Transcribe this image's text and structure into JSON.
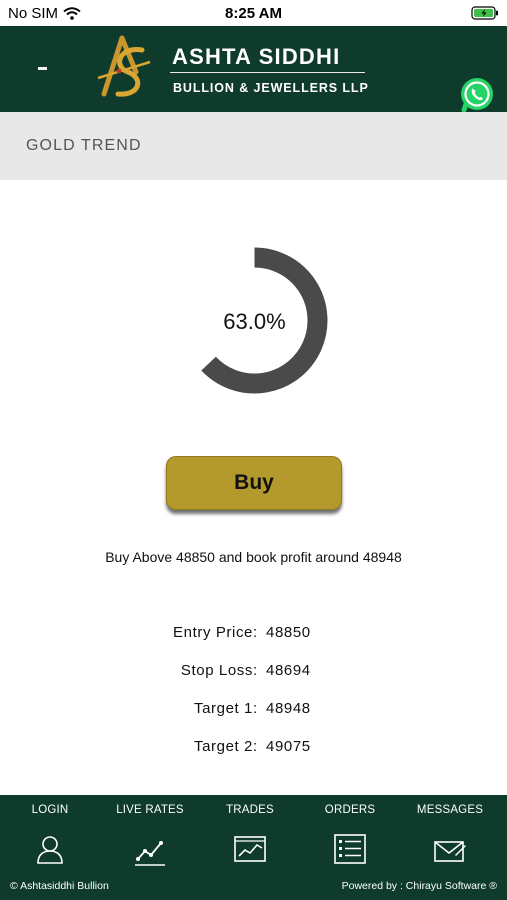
{
  "status": {
    "carrier": "No SIM",
    "time": "8:25 AM"
  },
  "header": {
    "brand_name": "ASHTA SIDDHI",
    "brand_sub": "BULLION & JEWELLERS LLP",
    "menu_icon": "hamburger-icon",
    "whatsapp_icon": "whatsapp-icon"
  },
  "section": {
    "title": "GOLD TREND"
  },
  "gauge": {
    "percent_label": "63.0%",
    "percent": 63.0,
    "color": "#4a4a4a"
  },
  "signal": {
    "action_label": "Buy",
    "action_color": "#b49a2c",
    "advice": "Buy Above 48850 and book profit around 48948"
  },
  "levels": [
    {
      "label": "Entry Price",
      "value": "48850"
    },
    {
      "label": "Stop Loss",
      "value": "48694"
    },
    {
      "label": "Target 1",
      "value": "48948"
    },
    {
      "label": "Target 2",
      "value": "49075"
    }
  ],
  "nav": {
    "items": [
      {
        "label": "LOGIN",
        "icon": "user-icon"
      },
      {
        "label": "LIVE RATES",
        "icon": "line-chart-icon"
      },
      {
        "label": "TRADES",
        "icon": "trades-chart-icon"
      },
      {
        "label": "ORDERS",
        "icon": "orders-list-icon"
      },
      {
        "label": "MESSAGES",
        "icon": "envelope-icon"
      }
    ]
  },
  "footer": {
    "copyright": "© Ashtasiddhi Bullion",
    "powered_by": "Powered by : Chirayu Software ®"
  },
  "theme": {
    "primary": "#0e3b2b",
    "accent_gold": "#b49a2c"
  }
}
